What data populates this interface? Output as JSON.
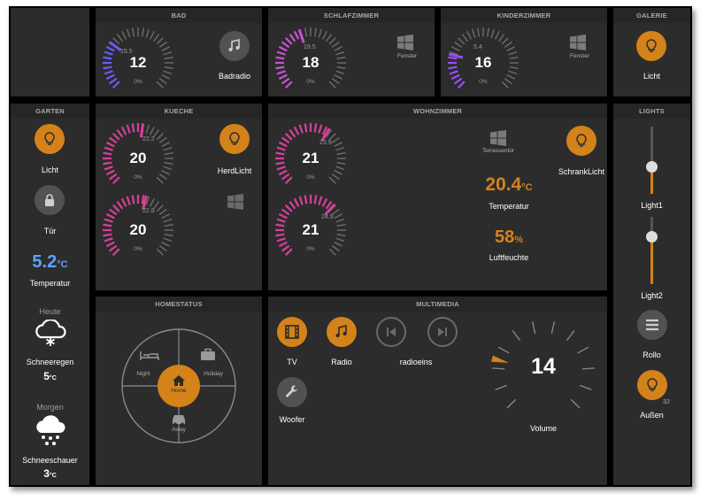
{
  "colors": {
    "accent": "#d4821a",
    "panel": "#2c2c2c",
    "header": "#262626",
    "blue": "#5ea2ff"
  },
  "bad": {
    "title": "BAD",
    "gauge": {
      "value": "12",
      "setpoint": "15.5",
      "percent": "0%",
      "level": 0.3,
      "color": "#6a5cff"
    },
    "radio_label": "Badradio",
    "radio_icon": "music-icon"
  },
  "schlafzimmer": {
    "title": "SCHLAFZIMMER",
    "gauge": {
      "value": "18",
      "setpoint": "19.5",
      "percent": "0%",
      "level": 0.43,
      "color": "#c851d8"
    },
    "window_label": "Fenster",
    "window_icon": "window-icon"
  },
  "kinderzimmer": {
    "title": "KINDERZIMMER",
    "gauge": {
      "value": "16",
      "setpoint": "5.4",
      "percent": "0%",
      "level": 0.22,
      "color": "#9b4cff"
    },
    "window_label": "Fenster",
    "window_icon": "window-icon"
  },
  "galerie": {
    "title": "GALERIE",
    "light_label": "Licht",
    "light_icon": "bulb-icon"
  },
  "garten": {
    "title": "GARTEN",
    "light_label": "Licht",
    "door_label": "Tür",
    "temp_value": "5.2",
    "temp_unit": "°C",
    "temp_label": "Temperatur",
    "today_title": "Heute",
    "today_desc": "Schneeregen",
    "today_temp": "5",
    "today_unit": "°C",
    "tomorrow_title": "Morgen",
    "tomorrow_desc": "Schneeschauer",
    "tomorrow_temp": "3",
    "tomorrow_unit": "°C"
  },
  "kueche": {
    "title": "KUECHE",
    "gauge1": {
      "value": "20",
      "setpoint": "22.2",
      "percent": "0%",
      "level": 0.53,
      "color": "#d8409a"
    },
    "gauge2": {
      "value": "20",
      "setpoint": "22.8",
      "percent": "0%",
      "level": 0.55,
      "color": "#d8409a"
    },
    "herd_label": "HerdLicht"
  },
  "wohnzimmer": {
    "title": "WOHNZIMMER",
    "gauge1": {
      "value": "21",
      "setpoint": "23.9",
      "percent": "0%",
      "level": 0.62,
      "color": "#d8409a"
    },
    "gauge2": {
      "value": "21",
      "setpoint": "24.9",
      "percent": "0%",
      "level": 0.66,
      "color": "#d8409a"
    },
    "terrace_label": "Terrassentür",
    "schrank_label": "SchrankLicht",
    "temp_value": "20.4",
    "temp_unit": "°C",
    "temp_label": "Temperatur",
    "humidity_value": "58",
    "humidity_unit": "%",
    "humidity_label": "Luftfeuchte"
  },
  "lights": {
    "title": "LIGHTS",
    "light1_label": "Light1",
    "light1_level": 0.4,
    "light2_label": "Light2",
    "light2_level": 0.7,
    "rollo_label": "Rollo",
    "aussen_label": "Außen",
    "aussen_value": "32"
  },
  "homestatus": {
    "title": "HOMESTATUS",
    "night": "Night",
    "holiday": "Holiday",
    "home": "Home",
    "away": "Away"
  },
  "multimedia": {
    "title": "MULTIMEDIA",
    "tv_label": "TV",
    "radio_label": "Radio",
    "station_label": "radioeins",
    "woofer_label": "Woofer",
    "volume_value": "14",
    "volume_label": "Volume",
    "volume_level": 0.22
  }
}
